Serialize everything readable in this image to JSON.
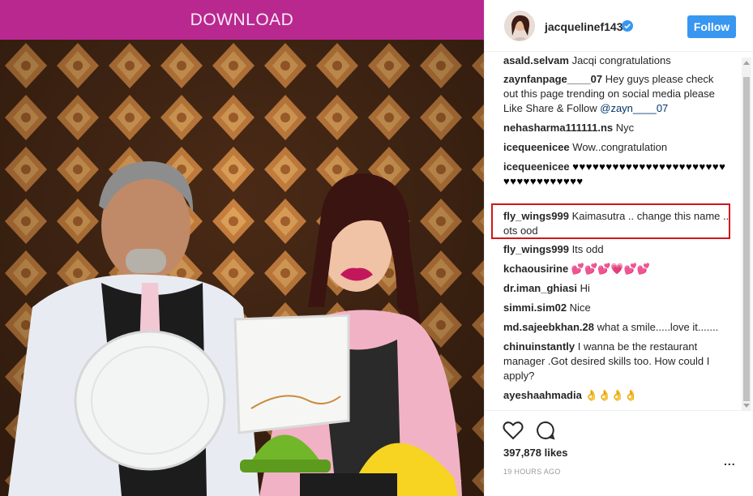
{
  "banner": {
    "label": "DOWNLOAD"
  },
  "post": {
    "username": "jacquelinef143",
    "follow_label": "Follow",
    "likes": "397,878 likes",
    "time_ago": "19 HOURS AGO",
    "more_label": "..."
  },
  "comments": [
    {
      "user": "asald.selvam",
      "text": "Jacqi congratulations"
    },
    {
      "user": "zaynfanpage____07",
      "text": "Hey guys please check out this page trending on social media please Like Share & Follow",
      "mention": "@zayn____07"
    },
    {
      "user": "nehasharma111111.ns",
      "text": "Nyc"
    },
    {
      "user": "icequeenicee",
      "text": "Wow..congratulation"
    },
    {
      "user": "icequeenicee",
      "text": "♥♥♥♥♥♥♥♥♥♥♥♥♥♥♥♥♥♥♥♥♥♥♥♥♥♥♥♥♥♥♥♥♥♥♥"
    },
    {
      "user": "fly_wings999",
      "text": "Kaimasutra .. change this name .. ots ood"
    },
    {
      "user": "fly_wings999",
      "text": "Its odd"
    },
    {
      "user": "kchaousirine",
      "text": "💕💕💕💗💕💕"
    },
    {
      "user": "dr.iman_ghiasi",
      "text": "Hi"
    },
    {
      "user": "simmi.sim02",
      "text": "Nice"
    },
    {
      "user": "md.sajeebkhan.28",
      "text": "what a smile.....love it......."
    },
    {
      "user": "chinuinstantly",
      "text": "I wanna be the restaurant manager .Got desired skills too. How could I apply?"
    },
    {
      "user": "ayeshaahmadia",
      "text": "👌👌👌👌"
    }
  ],
  "colors": {
    "banner": "#b8288f",
    "follow_button": "#3897f0",
    "highlight": "#d0161c",
    "verified": "#3897f0"
  },
  "icons": [
    "verified-badge-icon",
    "heart-icon",
    "comment-icon",
    "scroll-up-icon",
    "scroll-down-icon"
  ]
}
